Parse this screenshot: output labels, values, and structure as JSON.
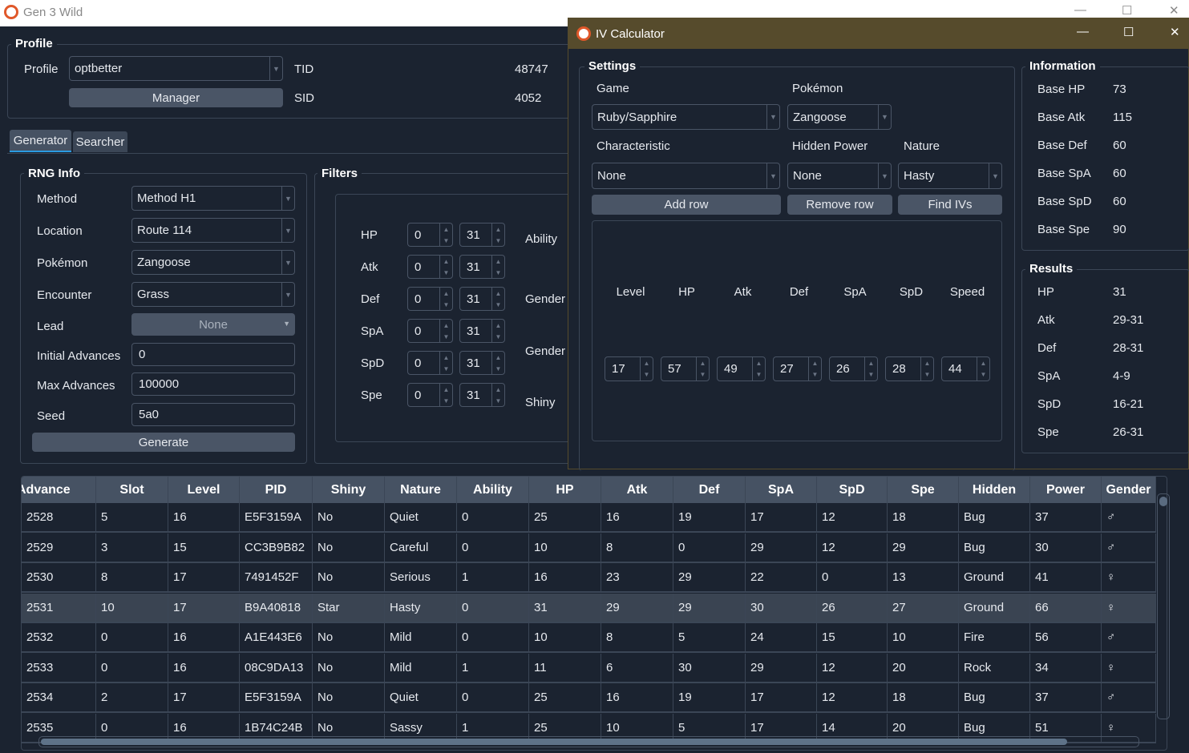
{
  "main_window": {
    "title": "Gen 3 Wild",
    "min": "—",
    "max": "☐",
    "close": "✕"
  },
  "profile": {
    "group": "Profile",
    "label": "Profile",
    "value": "optbetter",
    "manager": "Manager",
    "tid_label": "TID",
    "tid": "48747",
    "sid_label": "SID",
    "sid": "4052"
  },
  "tabs": [
    {
      "label": "Generator"
    },
    {
      "label": "Searcher"
    }
  ],
  "rng": {
    "group": "RNG Info",
    "fields": [
      {
        "label": "Method",
        "value": "Method H1",
        "type": "combo"
      },
      {
        "label": "Location",
        "value": "Route 114",
        "type": "combo"
      },
      {
        "label": "Pokémon",
        "value": "Zangoose",
        "type": "combo"
      },
      {
        "label": "Encounter",
        "value": "Grass",
        "type": "combo"
      },
      {
        "label": "Lead",
        "value": "None",
        "type": "button"
      },
      {
        "label": "Initial Advances",
        "value": "0",
        "type": "input"
      },
      {
        "label": "Max Advances",
        "value": "100000",
        "type": "input"
      },
      {
        "label": "Seed",
        "value": "5a0",
        "type": "input"
      }
    ],
    "generate": "Generate"
  },
  "filters": {
    "group": "Filters",
    "stats": [
      {
        "label": "HP",
        "min": "0",
        "max": "31"
      },
      {
        "label": "Atk",
        "min": "0",
        "max": "31"
      },
      {
        "label": "Def",
        "min": "0",
        "max": "31"
      },
      {
        "label": "SpA",
        "min": "0",
        "max": "31"
      },
      {
        "label": "SpD",
        "min": "0",
        "max": "31"
      },
      {
        "label": "Spe",
        "min": "0",
        "max": "31"
      }
    ],
    "ability": "Ability",
    "gender": "Gender",
    "gender_ratio": "Gender",
    "shiny": "Shiny"
  },
  "iv_calc": {
    "title": "IV Calculator",
    "colors": {
      "titlebar": "#564b2c"
    },
    "settings": {
      "group": "Settings",
      "game_label": "Game",
      "game": "Ruby/Sapphire",
      "pokemon_label": "Pokémon",
      "pokemon": "Zangoose",
      "characteristic_label": "Characteristic",
      "characteristic": "None",
      "hp_label": "Hidden Power",
      "hp": "None",
      "nature_label": "Nature",
      "nature": "Hasty",
      "add_row": "Add row",
      "remove_row": "Remove row",
      "find": "Find IVs",
      "columns": [
        "Level",
        "HP",
        "Atk",
        "Def",
        "SpA",
        "SpD",
        "Speed"
      ],
      "values": [
        "17",
        "57",
        "49",
        "27",
        "26",
        "28",
        "44"
      ]
    },
    "info": {
      "group": "Information",
      "rows": [
        {
          "label": "Base HP",
          "value": "73"
        },
        {
          "label": "Base Atk",
          "value": "115"
        },
        {
          "label": "Base Def",
          "value": "60"
        },
        {
          "label": "Base SpA",
          "value": "60"
        },
        {
          "label": "Base SpD",
          "value": "60"
        },
        {
          "label": "Base Spe",
          "value": "90"
        }
      ]
    },
    "results": {
      "group": "Results",
      "rows": [
        {
          "label": "HP",
          "value": "31"
        },
        {
          "label": "Atk",
          "value": "29-31"
        },
        {
          "label": "Def",
          "value": "28-31"
        },
        {
          "label": "SpA",
          "value": "4-9"
        },
        {
          "label": "SpD",
          "value": "16-21"
        },
        {
          "label": "Spe",
          "value": "26-31"
        }
      ]
    }
  },
  "table": {
    "headers": [
      "Advance",
      "Slot",
      "Level",
      "PID",
      "Shiny",
      "Nature",
      "Ability",
      "HP",
      "Atk",
      "Def",
      "SpA",
      "SpD",
      "Spe",
      "Hidden",
      "Power",
      "Gender"
    ],
    "selected_row": 3,
    "rows": [
      [
        "2528",
        "5",
        "16",
        "E5F3159A",
        "No",
        "Quiet",
        "0",
        "25",
        "16",
        "19",
        "17",
        "12",
        "18",
        "Bug",
        "37",
        "♂"
      ],
      [
        "2529",
        "3",
        "15",
        "CC3B9B82",
        "No",
        "Careful",
        "0",
        "10",
        "8",
        "0",
        "29",
        "12",
        "29",
        "Bug",
        "30",
        "♂"
      ],
      [
        "2530",
        "8",
        "17",
        "7491452F",
        "No",
        "Serious",
        "1",
        "16",
        "23",
        "29",
        "22",
        "0",
        "13",
        "Ground",
        "41",
        "♀"
      ],
      [
        "2531",
        "10",
        "17",
        "B9A40818",
        "Star",
        "Hasty",
        "0",
        "31",
        "29",
        "29",
        "30",
        "26",
        "27",
        "Ground",
        "66",
        "♀"
      ],
      [
        "2532",
        "0",
        "16",
        "A1E443E6",
        "No",
        "Mild",
        "0",
        "10",
        "8",
        "5",
        "24",
        "15",
        "10",
        "Fire",
        "56",
        "♂"
      ],
      [
        "2533",
        "0",
        "16",
        "08C9DA13",
        "No",
        "Mild",
        "1",
        "11",
        "6",
        "30",
        "29",
        "12",
        "20",
        "Rock",
        "34",
        "♀"
      ],
      [
        "2534",
        "2",
        "17",
        "E5F3159A",
        "No",
        "Quiet",
        "0",
        "25",
        "16",
        "19",
        "17",
        "12",
        "18",
        "Bug",
        "37",
        "♂"
      ],
      [
        "2535",
        "0",
        "16",
        "1B74C24B",
        "No",
        "Sassy",
        "1",
        "25",
        "10",
        "5",
        "17",
        "14",
        "20",
        "Bug",
        "51",
        "♀"
      ]
    ]
  }
}
